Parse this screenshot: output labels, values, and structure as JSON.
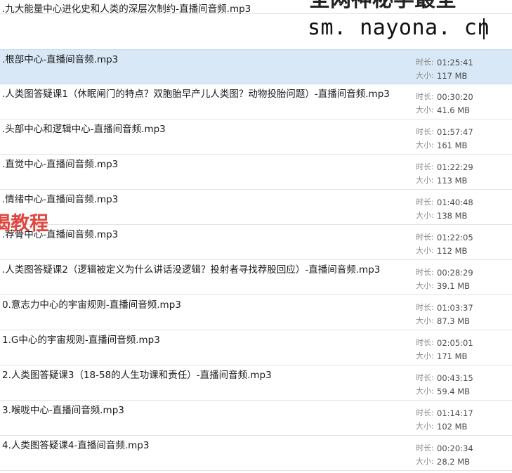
{
  "labels": {
    "duration": "时长:",
    "size": "大小:"
  },
  "watermark": {
    "url": "sm. nayona. cn",
    "top_text": "全网神秘学最全",
    "side_text": "揭教程"
  },
  "files": [
    {
      "name": ".九大能量中心进化史和人类的深层次制约-直播间音频.mp3",
      "duration": "",
      "size": ""
    },
    {
      "name": ".根部中心-直播间音频.mp3",
      "duration": "01:25:41",
      "size": "117 MB",
      "selected": true
    },
    {
      "name": ".人类图答疑课1（休眠闸门的特点？双胞胎早产儿人类图？动物投胎问题）-直播间音频.mp3",
      "duration": "00:30:20",
      "size": "41.6 MB"
    },
    {
      "name": ".头部中心和逻辑中心-直播间音频.mp3",
      "duration": "01:57:47",
      "size": "161 MB"
    },
    {
      "name": ".直觉中心-直播间音频.mp3",
      "duration": "01:22:29",
      "size": "113 MB"
    },
    {
      "name": ".情绪中心-直播间音频.mp3",
      "duration": "01:40:48",
      "size": "138 MB"
    },
    {
      "name": ".荐骨中心-直播间音频.mp3",
      "duration": "01:22:05",
      "size": "112 MB"
    },
    {
      "name": ".人类图答疑课2（逻辑被定义为什么讲话没逻辑？投射者寻找荐股回应）-直播间音频.mp3",
      "duration": "00:28:29",
      "size": "39.1 MB"
    },
    {
      "name": "0.意志力中心的宇宙规则-直播间音频.mp3",
      "duration": "01:03:37",
      "size": "87.3 MB"
    },
    {
      "name": "1.G中心的宇宙规则-直播间音频.mp3",
      "duration": "02:05:01",
      "size": "171 MB"
    },
    {
      "name": "2.人类图答疑课3（18-58的人生功课和责任）-直播间音频.mp3",
      "duration": "00:43:15",
      "size": "59.4 MB"
    },
    {
      "name": "3.喉咙中心-直播间音频.mp3",
      "duration": "01:14:17",
      "size": "102 MB"
    },
    {
      "name": "4.人类图答疑课4-直播间音频.mp3",
      "duration": "00:20:34",
      "size": "28.2 MB"
    }
  ]
}
